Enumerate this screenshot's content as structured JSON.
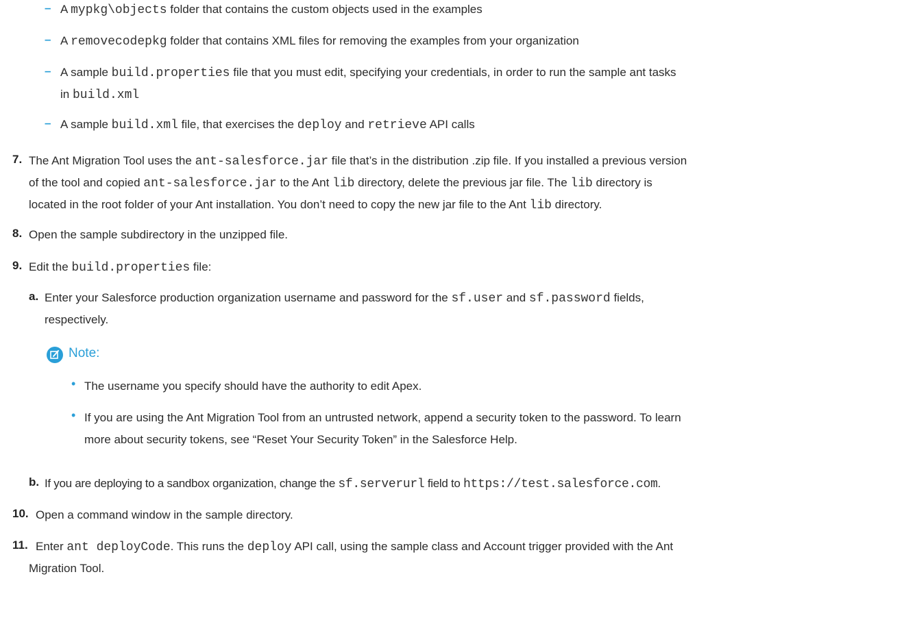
{
  "sub_items": [
    {
      "pre": "A ",
      "code": "mypkg\\objects",
      "post": " folder that contains the custom objects used in the examples"
    },
    {
      "pre": "A ",
      "code": "removecodepkg",
      "post": " folder that contains XML files for removing the examples from your organization"
    },
    {
      "pre": "A sample ",
      "code": "build.properties",
      "mid": " file that you must edit, specifying your credentials, in order to run the sample ant tasks",
      "line2_pre": "in ",
      "line2_code": "build.xml"
    },
    {
      "pre": "A sample ",
      "code": "build.xml",
      "mid": " file, that exercises the ",
      "code2": "deploy",
      "mid2": " and ",
      "code3": "retrieve",
      "post": " API calls"
    }
  ],
  "step7": {
    "number": "7.",
    "l1_a": "The Ant Migration Tool uses the ",
    "l1_code": "ant-salesforce.jar",
    "l1_b": " file that’s in the distribution .zip file. If you installed a previous version",
    "l2_a": "of the tool and copied ",
    "l2_code": "ant-salesforce.jar",
    "l2_b": " to the Ant ",
    "l2_code2": "lib",
    "l2_c": " directory, delete the previous jar file. The ",
    "l2_code3": "lib",
    "l2_d": " directory is",
    "l3_a": "located in the root folder of your Ant installation. You don’t need to copy the new jar file to the Ant ",
    "l3_code": "lib",
    "l3_b": " directory."
  },
  "step8": {
    "number": "8.",
    "text": "Open the sample subdirectory in the unzipped file."
  },
  "step9": {
    "number": "9.",
    "pre": "Edit the ",
    "code": "build.properties",
    "post": " file:"
  },
  "step9a": {
    "letter": "a.",
    "l1_a": "Enter your Salesforce production organization username and password for the ",
    "l1_code": "sf.user",
    "l1_b": " and ",
    "l1_code2": "sf.password",
    "l1_c": " fields,",
    "l2": "respectively."
  },
  "note": {
    "label": "Note:",
    "bullets": [
      "The username you specify should have the authority to edit Apex.",
      "If you are using the Ant Migration Tool from an untrusted network, append a security token to the password. To learn"
    ],
    "bullet2_line2": "more about security tokens, see “Reset Your Security Token” in the Salesforce Help."
  },
  "step9b": {
    "letter": "b.",
    "pre": "If you are deploying to a sandbox organization, change the ",
    "code": "sf.serverurl",
    "mid": " field to ",
    "code2": "https://test.salesforce.com",
    "post": "."
  },
  "step10": {
    "number": "10.",
    "text": "Open a command window in the sample directory."
  },
  "step11": {
    "number": "11.",
    "pre": "Enter ",
    "code": "ant deployCode",
    "mid": ". This runs the ",
    "code2": "deploy",
    "post": " API call, using the sample class and Account trigger provided with the Ant",
    "l2": "Migration Tool."
  }
}
